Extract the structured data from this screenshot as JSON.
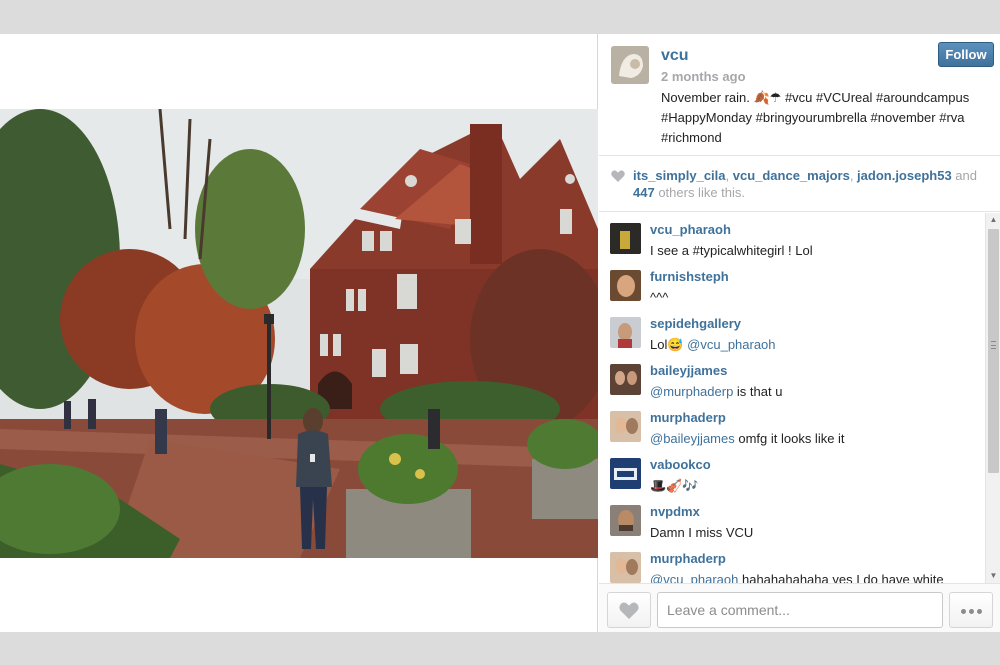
{
  "post": {
    "username": "vcu",
    "time_ago": "2 months ago",
    "caption_text": "November rain. ",
    "caption_emoji": "🍂☂",
    "caption_tags": " #vcu #VCUreal #aroundcampus #HappyMonday #bringyourumbrella #november #rva #richmond",
    "follow_label": "Follow"
  },
  "likes": {
    "users": [
      "its_simply_cila",
      "vcu_dance_majors",
      "jadon.joseph53"
    ],
    "sep1": ", ",
    "sep2": ", ",
    "and_text": " and ",
    "others_count": "447",
    "others_text": " others like this."
  },
  "comments": [
    {
      "user": "vcu_pharaoh",
      "mention": "",
      "text": "I see a #typicalwhitegirl ! Lol",
      "avatar_color": "#2b2a26"
    },
    {
      "user": "furnishsteph",
      "mention": "",
      "text": "^^^",
      "avatar_color": "#8a5a3c"
    },
    {
      "user": "sepidehgallery",
      "mention": "@vcu_pharaoh",
      "text": "Lol😅 ",
      "avatar_color": "#b98f7a"
    },
    {
      "user": "baileyjjames",
      "mention": "@murphaderp",
      "text": " is that u",
      "avatar_color": "#6a4a3a"
    },
    {
      "user": "murphaderp",
      "mention": "@baileyjjames",
      "text": " omfg it looks like it",
      "avatar_color": "#c9a78a"
    },
    {
      "user": "vabookco",
      "mention": "",
      "text": "🎩🎻🎶",
      "avatar_color": "#1f3f73"
    },
    {
      "user": "nvpdmx",
      "mention": "",
      "text": "Damn I miss VCU",
      "avatar_color": "#5a4a40"
    },
    {
      "user": "murphaderp",
      "mention": "@vcu_pharaoh",
      "text": " hahahahahaha yes I do have white",
      "avatar_color": "#c9a78a"
    }
  ],
  "footer": {
    "comment_placeholder": "Leave a comment..."
  },
  "icons": {
    "like": "heart-icon",
    "more": "ellipsis-icon",
    "scroll_up": "up-arrow-icon",
    "scroll_down": "down-arrow-icon"
  },
  "colors": {
    "link": "#3f729b",
    "follow_button": "#3f729b",
    "muted": "#a5a7aa"
  }
}
